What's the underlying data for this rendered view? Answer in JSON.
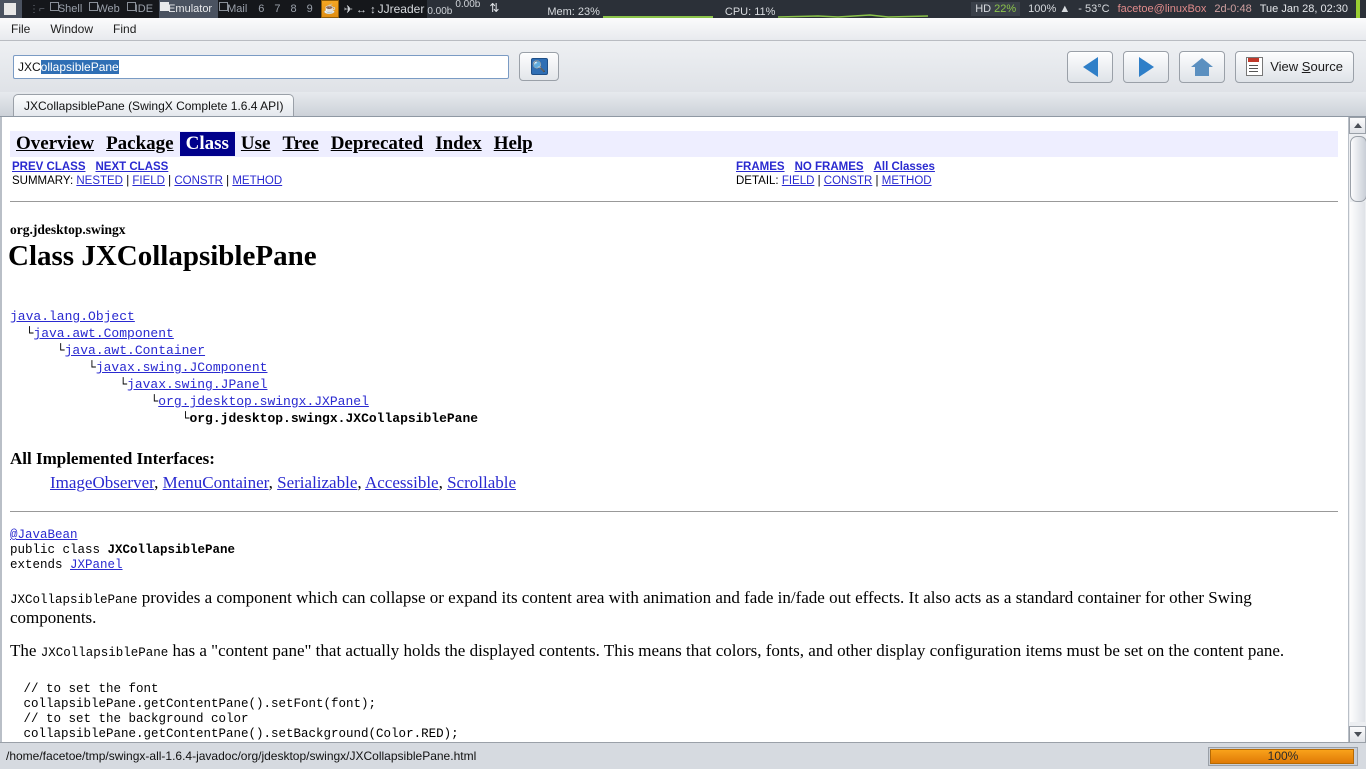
{
  "sysbar": {
    "workspaces": [
      {
        "label": "Shell",
        "active": false
      },
      {
        "label": "Web",
        "active": false
      },
      {
        "label": "IDE",
        "active": false
      },
      {
        "label": "Emulator",
        "active": true
      },
      {
        "label": "Mail",
        "active": false
      }
    ],
    "numbers": [
      "6",
      "7",
      "8",
      "9"
    ],
    "app_icon": "java-icon",
    "layout_icons": "✈ ↔ ↕",
    "window_title": "JJreader",
    "net_up": "0.00b",
    "net_down": "0.00b",
    "mem_label": "Mem: 23%",
    "cpu_label": "CPU: 11%",
    "hd_label": "HD",
    "hd_value": "22%",
    "battery": "100%",
    "battery_state": "▲",
    "temperature": "- 53°C",
    "user_host": "facetoe@linuxBox",
    "uptime": "2d-0:48",
    "clock": "Tue Jan 28, 02:30"
  },
  "menubar": {
    "items": [
      "File",
      "Window",
      "Find"
    ]
  },
  "toolbar": {
    "search_typed": "JXC",
    "search_selected": "ollapsiblePane",
    "search_full": "JXCollapsiblePane",
    "search_button_icon": "search-icon",
    "back_icon": "arrow-left-icon",
    "forward_icon": "arrow-right-icon",
    "home_icon": "home-icon",
    "view_source_label_pre": "View ",
    "view_source_accel": "S",
    "view_source_label_post": "ource"
  },
  "tabs": [
    {
      "label": "JXCollapsiblePane (SwingX Complete 1.6.4 API)",
      "active": true
    }
  ],
  "javadoc": {
    "navbar": [
      {
        "label": "Overview",
        "current": false
      },
      {
        "label": "Package",
        "current": false
      },
      {
        "label": "Class",
        "current": true
      },
      {
        "label": "Use",
        "current": false
      },
      {
        "label": "Tree",
        "current": false
      },
      {
        "label": "Deprecated",
        "current": false
      },
      {
        "label": "Index",
        "current": false
      },
      {
        "label": "Help",
        "current": false
      }
    ],
    "subnav": {
      "prev_class": "PREV CLASS",
      "next_class": "NEXT CLASS",
      "summary_label": "SUMMARY:",
      "summary_items": [
        "NESTED",
        "FIELD",
        "CONSTR",
        "METHOD"
      ],
      "frames": "FRAMES",
      "no_frames": "NO FRAMES",
      "all_classes": "All Classes",
      "detail_label": "DETAIL:",
      "detail_items": [
        "FIELD",
        "CONSTR",
        "METHOD"
      ]
    },
    "package": "org.jdesktop.swingx",
    "class_title": "Class JXCollapsiblePane",
    "hierarchy": [
      {
        "indent": 0,
        "text": "java.lang.Object",
        "link": true,
        "branch": false
      },
      {
        "indent": 1,
        "text": "java.awt.Component",
        "link": true,
        "branch": true
      },
      {
        "indent": 2,
        "text": "java.awt.Container",
        "link": true,
        "branch": true
      },
      {
        "indent": 3,
        "text": "javax.swing.JComponent",
        "link": true,
        "branch": true
      },
      {
        "indent": 4,
        "text": "javax.swing.JPanel",
        "link": true,
        "branch": true
      },
      {
        "indent": 5,
        "text": "org.jdesktop.swingx.JXPanel",
        "link": true,
        "branch": true
      },
      {
        "indent": 6,
        "text": "org.jdesktop.swingx.JXCollapsiblePane",
        "link": false,
        "branch": true
      }
    ],
    "implemented_heading": "All Implemented Interfaces:",
    "implemented": [
      "ImageObserver",
      "MenuContainer",
      "Serializable",
      "Accessible",
      "Scrollable"
    ],
    "annotation": "@JavaBean",
    "decl_modifier": "public class ",
    "decl_class": "JXCollapsiblePane",
    "decl_extends_kw": "extends ",
    "decl_extends_type": "JXPanel",
    "paragraph1_code": "JXCollapsiblePane",
    "paragraph1_text": " provides a component which can collapse or expand its content area with animation and fade in/fade out effects. It also acts as a standard container for other Swing components.",
    "paragraph2_pre": "The ",
    "paragraph2_code": "JXCollapsiblePane",
    "paragraph2_post": " has a \"content pane\" that actually holds the displayed contents. This means that colors, fonts, and other display configuration items must be set on the content pane.",
    "code_block": " // to set the font\n collapsiblePane.getContentPane().setFont(font);\n // to set the background color\n collapsiblePane.getContentPane().setBackground(Color.RED);"
  },
  "statusbar": {
    "path": "/home/facetoe/tmp/swingx-all-1.6.4-javadoc/org/jdesktop/swingx/JXCollapsiblePane.html",
    "progress_text": "100%",
    "progress_percent": 100
  },
  "colors": {
    "accent_blue": "#2f6fb5",
    "link": "#2a2ad0",
    "current_nav_bg": "#00008b",
    "progress_orange": "#e07a06",
    "sysbar_bg": "#2b3038"
  }
}
